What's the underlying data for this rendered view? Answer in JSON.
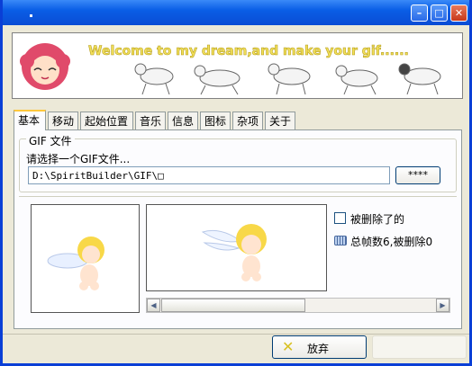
{
  "titlebar": {
    "min_glyph": "–",
    "max_glyph": "□",
    "close_glyph": "✕"
  },
  "banner": {
    "text": "Welcome to my dream,and make your gif......"
  },
  "tabs": [
    {
      "label": "基本",
      "active": true
    },
    {
      "label": "移动"
    },
    {
      "label": "起始位置"
    },
    {
      "label": "音乐"
    },
    {
      "label": "信息"
    },
    {
      "label": "图标"
    },
    {
      "label": "杂项"
    },
    {
      "label": "关于"
    }
  ],
  "gif_group": {
    "legend": "GIF 文件",
    "prompt": "请选择一个GIF文件...",
    "path_value": "D:\\SpiritBuilder\\GIF\\□",
    "browse_label": "****"
  },
  "preview": {
    "deleted_checkbox_label": "被删除了的",
    "deleted_checked": false,
    "frames_text": "总帧数6,被删除0"
  },
  "footer": {
    "cancel_label": "放弃"
  },
  "colors": {
    "titlebar": "#0a5ee6",
    "banner_text": "#f2e05a",
    "tab_highlight": "#ffc83c"
  }
}
